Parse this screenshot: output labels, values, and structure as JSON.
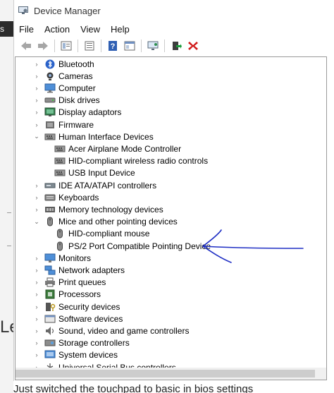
{
  "window": {
    "title": "Device Manager"
  },
  "menu": [
    "File",
    "Action",
    "View",
    "Help"
  ],
  "toolbar_icons": [
    "back-icon",
    "forward-icon",
    "properties-icon",
    "update-driver-icon",
    "help-icon",
    "view-icon",
    "scan-hardware-icon",
    "enable-device-icon",
    "uninstall-icon"
  ],
  "tree": [
    {
      "label": "Bluetooth",
      "level": 0,
      "expander": "›",
      "icon": "bluetooth-icon"
    },
    {
      "label": "Cameras",
      "level": 0,
      "expander": "›",
      "icon": "camera-icon"
    },
    {
      "label": "Computer",
      "level": 0,
      "expander": "›",
      "icon": "computer-icon"
    },
    {
      "label": "Disk drives",
      "level": 0,
      "expander": "›",
      "icon": "disk-icon"
    },
    {
      "label": "Display adaptors",
      "level": 0,
      "expander": "›",
      "icon": "display-icon"
    },
    {
      "label": "Firmware",
      "level": 0,
      "expander": "›",
      "icon": "firmware-icon"
    },
    {
      "label": "Human Interface Devices",
      "level": 0,
      "expander": "⌄",
      "icon": "hid-icon"
    },
    {
      "label": "Acer Airplane Mode Controller",
      "level": 1,
      "expander": "",
      "icon": "hid-icon"
    },
    {
      "label": "HID-compliant wireless radio controls",
      "level": 1,
      "expander": "",
      "icon": "hid-icon"
    },
    {
      "label": "USB Input Device",
      "level": 1,
      "expander": "",
      "icon": "hid-icon"
    },
    {
      "label": "IDE ATA/ATAPI controllers",
      "level": 0,
      "expander": "›",
      "icon": "ide-icon"
    },
    {
      "label": "Keyboards",
      "level": 0,
      "expander": "›",
      "icon": "keyboard-icon"
    },
    {
      "label": "Memory technology devices",
      "level": 0,
      "expander": "›",
      "icon": "memory-icon"
    },
    {
      "label": "Mice and other pointing devices",
      "level": 0,
      "expander": "⌄",
      "icon": "mouse-icon"
    },
    {
      "label": "HID-compliant mouse",
      "level": 1,
      "expander": "",
      "icon": "mouse-icon"
    },
    {
      "label": "PS/2 Port Compatible Pointing Device",
      "level": 1,
      "expander": "",
      "icon": "mouse-icon"
    },
    {
      "label": "Monitors",
      "level": 0,
      "expander": "›",
      "icon": "monitor-icon"
    },
    {
      "label": "Network adapters",
      "level": 0,
      "expander": "›",
      "icon": "network-icon"
    },
    {
      "label": "Print queues",
      "level": 0,
      "expander": "›",
      "icon": "printer-icon"
    },
    {
      "label": "Processors",
      "level": 0,
      "expander": "›",
      "icon": "processor-icon"
    },
    {
      "label": "Security devices",
      "level": 0,
      "expander": "›",
      "icon": "security-icon"
    },
    {
      "label": "Software devices",
      "level": 0,
      "expander": "›",
      "icon": "software-icon"
    },
    {
      "label": "Sound, video and game controllers",
      "level": 0,
      "expander": "›",
      "icon": "sound-icon"
    },
    {
      "label": "Storage controllers",
      "level": 0,
      "expander": "›",
      "icon": "storage-icon"
    },
    {
      "label": "System devices",
      "level": 0,
      "expander": "›",
      "icon": "system-icon"
    },
    {
      "label": "Universal Serial Bus controllers",
      "level": 0,
      "expander": "›",
      "icon": "usb-icon"
    }
  ],
  "background": {
    "left_tab_text": "s",
    "big_letters": "Le",
    "caption": "Just switched the touchpad to basic in bios settings"
  },
  "colors": {
    "annotation": "#1f2fc4",
    "uninstall": "#d01818",
    "accent": "#3a76c4"
  }
}
